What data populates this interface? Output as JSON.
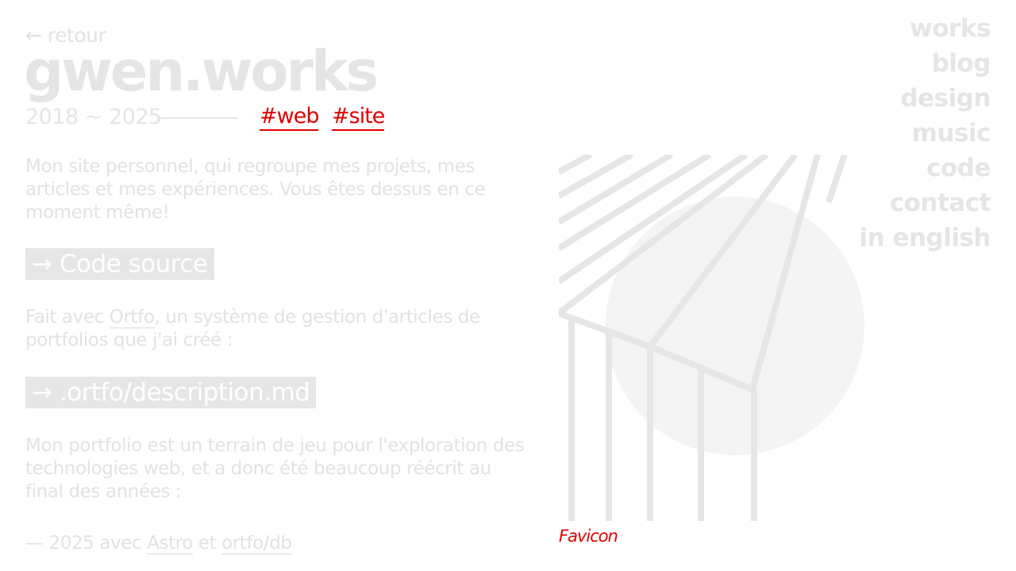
{
  "back": {
    "label": "← retour"
  },
  "title": "gwen.works",
  "years": "2018 ~ 2025",
  "tags": [
    {
      "label": "#web"
    },
    {
      "label": "#site"
    }
  ],
  "intro": {
    "text": "Mon site personnel, qui regroupe mes projets, mes articles et mes expériences. Vous êtes dessus en ce moment même!"
  },
  "code_source_button": "→ Code source",
  "made_with": {
    "before": "Fait avec ",
    "link": "Ortfo",
    "after": ", un système de gestion d'articles de portfolios que j'ai créé :"
  },
  "description_button": "→ .ortfo/description.md",
  "history": {
    "text": "Mon portfolio est un terrain de jeu pour l'exploration des technologies web, et a donc été beaucoup réécrit au final des années :"
  },
  "version_2025": {
    "prefix": "— 2025 avec ",
    "link1": "Astro",
    "middle": " et ",
    "link2": "ortfo/db"
  },
  "nav": {
    "items": [
      {
        "label": "works"
      },
      {
        "label": "blog"
      },
      {
        "label": "design"
      },
      {
        "label": "music"
      },
      {
        "label": "code"
      },
      {
        "label": "contact"
      },
      {
        "label": "in english"
      }
    ]
  },
  "artwork": {
    "caption": "Favicon"
  },
  "colors": {
    "text_faded": "#e5e5e5",
    "accent_red": "#e00000",
    "button_bg": "#e6e6e6",
    "circle_fill": "#f4f4f4"
  }
}
